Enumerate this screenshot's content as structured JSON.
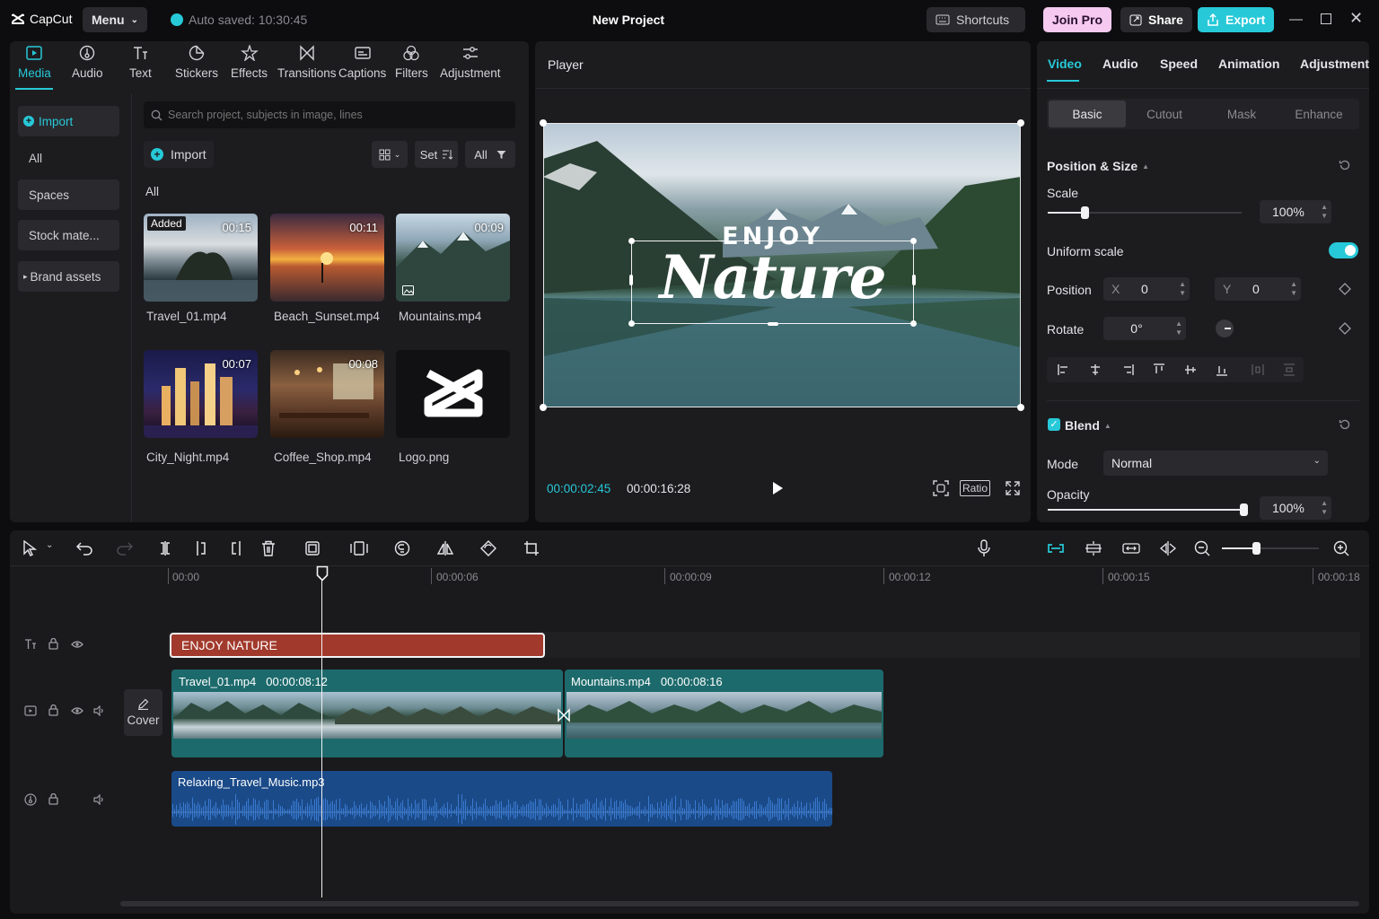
{
  "app": {
    "name": "CapCut",
    "menu_label": "Menu",
    "autosave": "Auto saved: 10:30:45",
    "project_title": "New Project"
  },
  "header": {
    "shortcuts": "Shortcuts",
    "join_pro": "Join Pro",
    "share": "Share",
    "export": "Export"
  },
  "tool_tabs": [
    "Media",
    "Audio",
    "Text",
    "Stickers",
    "Effects",
    "Transitions",
    "Captions",
    "Filters",
    "Adjustment"
  ],
  "sidebar": {
    "import": "Import",
    "items": [
      "All",
      "Spaces",
      "Stock mate...",
      "Brand assets"
    ]
  },
  "media": {
    "search_placeholder": "Search project, subjects in image, lines",
    "import_label": "Import",
    "sort_label": "Set",
    "filter_label": "All",
    "section_label": "All",
    "added_badge": "Added",
    "items": [
      {
        "name": "Travel_01.mp4",
        "duration": "00:15"
      },
      {
        "name": "Beach_Sunset.mp4",
        "duration": "00:11"
      },
      {
        "name": "Mountains.mp4",
        "duration": "00:09"
      },
      {
        "name": "City_Night.mp4",
        "duration": "00:07"
      },
      {
        "name": "Coffee_Shop.mp4",
        "duration": "00:08"
      },
      {
        "name": "Logo.png",
        "duration": ""
      }
    ]
  },
  "player": {
    "title": "Player",
    "overlay_line1": "ENJOY",
    "overlay_line2": "Nature",
    "current_time": "00:00:02:45",
    "total_time": "00:00:16:28",
    "ratio_label": "Ratio"
  },
  "props": {
    "tabs": [
      "Video",
      "Audio",
      "Speed",
      "Animation",
      "Adjustment"
    ],
    "subtabs": [
      "Basic",
      "Cutout",
      "Mask",
      "Enhance"
    ],
    "position_size": "Position & Size",
    "scale_label": "Scale",
    "scale_value": "100%",
    "scale_fraction": 0.19,
    "uniform_scale": "Uniform scale",
    "position_label": "Position",
    "x_label": "X",
    "x_value": "0",
    "y_label": "Y",
    "y_value": "0",
    "rotate_label": "Rotate",
    "rotate_value": "0°",
    "blend_label": "Blend",
    "mode_label": "Mode",
    "mode_value": "Normal",
    "opacity_label": "Opacity",
    "opacity_value": "100%",
    "opacity_fraction": 1.0
  },
  "timeline": {
    "ruler": [
      "00:00",
      "00:00:06",
      "00:00:09",
      "00:00:12",
      "00:00:15",
      "00:00:18"
    ],
    "text_clip": "ENJOY NATURE",
    "clip1_name": "Travel_01.mp4",
    "clip1_duration": "00:00:08:12",
    "clip2_name": "Mountains.mp4",
    "clip2_duration": "00:00:08:16",
    "audio_clip": "Relaxing_Travel_Music.mp3",
    "cover_label": "Cover"
  },
  "colors": {
    "accent": "#27c9d8",
    "text_clip": "#a13a2c",
    "video_clip": "#1d6a6c",
    "audio_clip": "#1a4a88",
    "join_pro": "#f5c9f0"
  }
}
